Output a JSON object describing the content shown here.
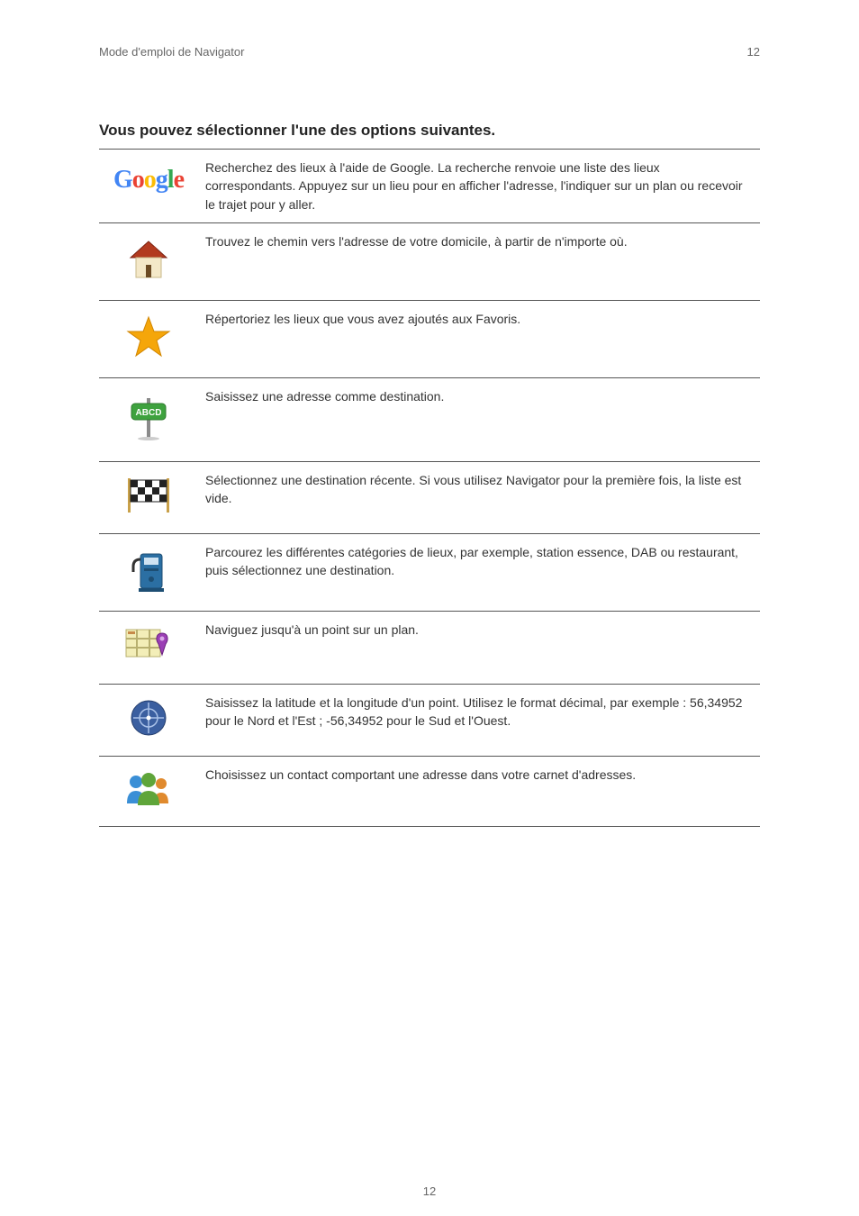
{
  "header": {
    "left": "Mode d'emploi de Navigator",
    "right": "12"
  },
  "section_title": "Vous pouvez sélectionner l'une des options suivantes.",
  "rows": [
    {
      "icon": "google",
      "text": "Recherchez des lieux à l'aide de Google. La recherche renvoie une liste des lieux correspondants. Appuyez sur un lieu pour en afficher l'adresse, l'indiquer sur un plan ou recevoir le trajet pour y aller."
    },
    {
      "icon": "home",
      "text": "Trouvez le chemin vers l'adresse de votre domicile, à partir de n'importe où."
    },
    {
      "icon": "star",
      "text": "Répertoriez les lieux que vous avez ajoutés aux Favoris."
    },
    {
      "icon": "signpost",
      "text": "Saisissez une adresse comme destination."
    },
    {
      "icon": "flag",
      "text": "Sélectionnez une destination récente. Si vous utilisez Navigator pour la première fois, la liste est vide."
    },
    {
      "icon": "gas",
      "text": "Parcourez les différentes catégories de lieux, par exemple, station essence, DAB ou restaurant, puis sélectionnez une destination."
    },
    {
      "icon": "mappin",
      "text": "Naviguez jusqu'à un point sur un plan."
    },
    {
      "icon": "globe",
      "text": "Saisissez la latitude et la longitude d'un point. Utilisez le format décimal, par exemple : 56,34952 pour le Nord et l'Est ; -56,34952 pour le Sud et l'Ouest."
    },
    {
      "icon": "contacts",
      "text": "Choisissez un contact comportant une adresse dans votre carnet d'adresses."
    }
  ],
  "footer": {
    "page": "12"
  }
}
